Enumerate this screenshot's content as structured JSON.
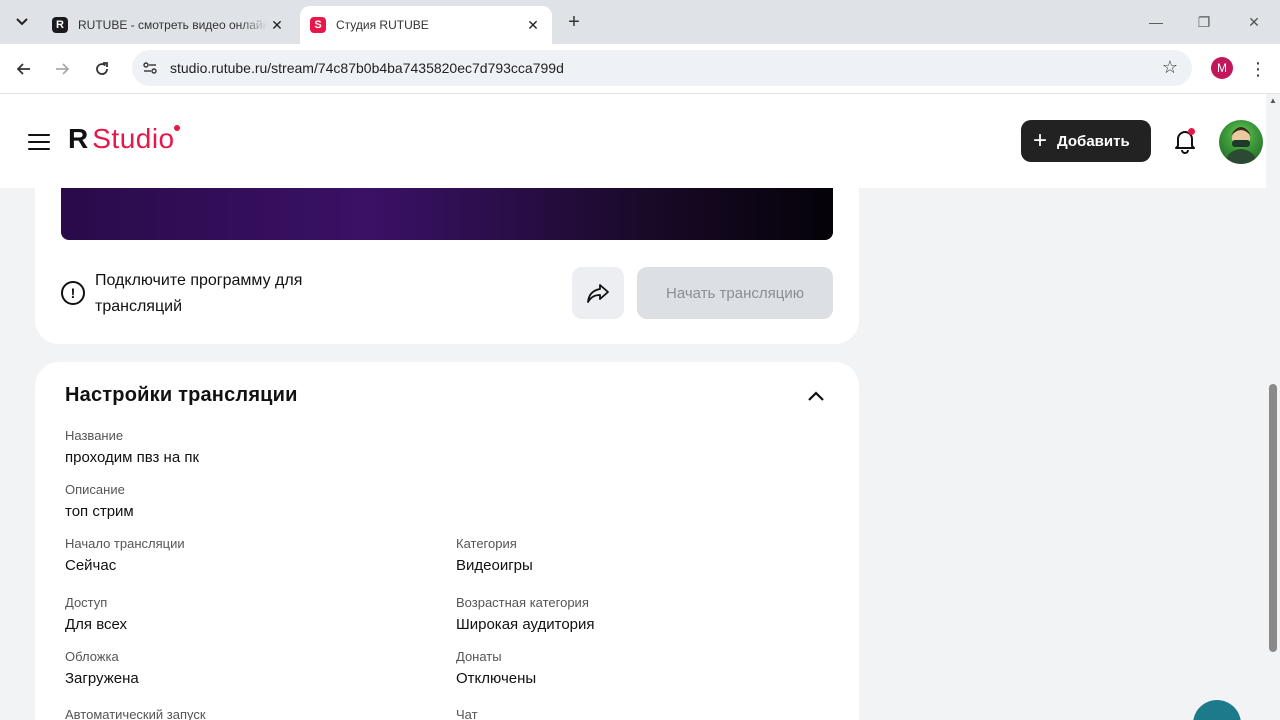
{
  "browser": {
    "tabs": [
      {
        "favicon": "R",
        "title": "RUTUBE - смотреть видео онлайн",
        "active": false
      },
      {
        "favicon": "S",
        "title": "Студия RUTUBE",
        "active": true
      }
    ],
    "url": "studio.rutube.ru/stream/74c87b0b4ba7435820ec7d793cca799d",
    "profile_initial": "M"
  },
  "header": {
    "logo_r": "R",
    "logo_studio": "Studio",
    "add_label": "Добавить"
  },
  "stream": {
    "warning": "Подключите программу для трансляций",
    "start_label": "Начать трансляцию"
  },
  "settings": {
    "title": "Настройки трансляции",
    "fields": {
      "name": {
        "label": "Название",
        "value": "проходим пвз на пк"
      },
      "description": {
        "label": "Описание",
        "value": "топ стрим"
      },
      "start": {
        "label": "Начало трансляции",
        "value": "Сейчас"
      },
      "category": {
        "label": "Категория",
        "value": "Видеоигры"
      },
      "access": {
        "label": "Доступ",
        "value": "Для всех"
      },
      "age": {
        "label": "Возрастная категория",
        "value": "Широкая аудитория"
      },
      "cover": {
        "label": "Обложка",
        "value": "Загружена"
      },
      "donations": {
        "label": "Донаты",
        "value": "Отключены"
      },
      "autostart": {
        "label": "Автоматический запуск"
      },
      "chat": {
        "label": "Чат"
      }
    }
  },
  "colors": {
    "accent": "#e8174a",
    "dark_button": "#222222"
  }
}
